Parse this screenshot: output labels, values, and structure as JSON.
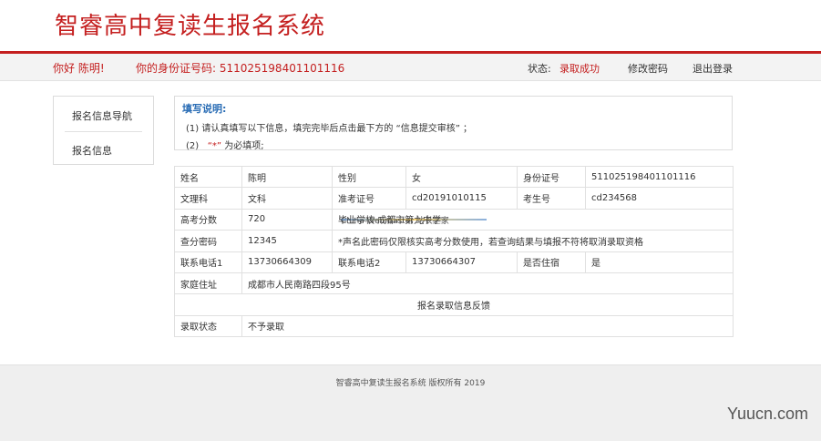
{
  "header": {
    "title": "智睿高中复读生报名系统",
    "brand_color": "#c41f1f"
  },
  "userbar": {
    "greeting": "你好 陈明!",
    "id_label": "你的身份证号码: 511025198401101116",
    "status_label": "状态:",
    "status_value": "录取成功",
    "change_password": "修改密码",
    "logout": "退出登录"
  },
  "sidebar": {
    "items": [
      {
        "label": "报名信息导航"
      },
      {
        "label": "报名信息"
      }
    ]
  },
  "notice": {
    "title": "填写说明:",
    "line1": "(1) 请认真填写以下信息，填完完毕后点击最下方的 “信息提交审核” ；",
    "line2_prefix": "(2)",
    "line2_star": "“*”",
    "line2_suffix": "为必填项;"
  },
  "table": {
    "name_label": "姓名",
    "name_value": "陈明",
    "gender_label": "性别",
    "gender_value": "女",
    "idcard_label": "身份证号",
    "idcard_value": "511025198401101116",
    "track_label": "文理科",
    "track_value": "文科",
    "ticket_label": "准考证号",
    "ticket_value": "cd20191010115",
    "exam_no_label": "考生号",
    "exam_no_value": "cd234568",
    "score_label": "高考分数",
    "score_value": "720",
    "school_text": "毕业学校    成都市第九中学",
    "query_pw_label": "查分密码",
    "query_pw_value": "12345",
    "query_pw_note": "*声名此密码仅限核实高考分数使用，若查询结果与填报不符将取消录取资格",
    "phone1_label": "联系电话1",
    "phone1_value": "13730664309",
    "phone2_label": "联系电话2",
    "phone2_value": "13730664307",
    "boarding_label": "是否住宿",
    "boarding_value": "是",
    "address_label": "家庭住址",
    "address_value": "成都市人民南路四段95号",
    "feedback_header": "报名录取信息反馈",
    "admit_label": "录取状态",
    "admit_value": "不予录取"
  },
  "watermark": {
    "text": "China Webmaster 站长之家"
  },
  "footer": {
    "copyright": "智睿高中复读生报名系统 版权所有  2019",
    "site_mark": "Yuucn.com"
  }
}
